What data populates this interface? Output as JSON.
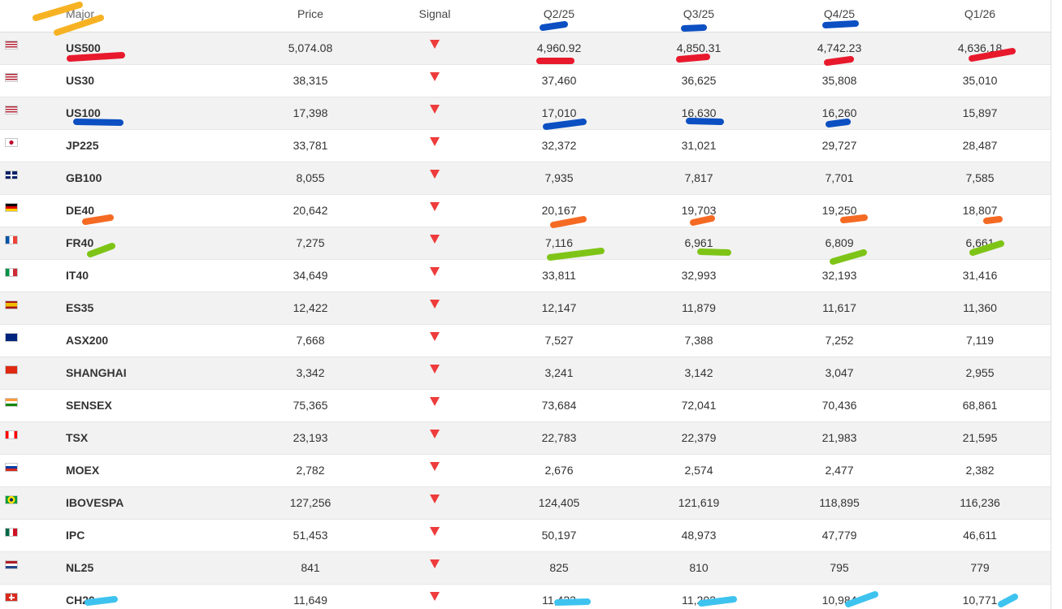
{
  "table": {
    "headers": {
      "major": "Major",
      "price": "Price",
      "signal": "Signal",
      "q1": "Q2/25",
      "q2": "Q3/25",
      "q3": "Q4/25",
      "q4": "Q1/26"
    },
    "signal_color": "#ee3b3b",
    "rows": [
      {
        "flag": "us",
        "name": "US500",
        "price": "5,074.08",
        "signal": "down",
        "q1": "4,960.92",
        "q2": "4,850.31",
        "q3": "4,742.23",
        "q4": "4,636.18"
      },
      {
        "flag": "us",
        "name": "US30",
        "price": "38,315",
        "signal": "down",
        "q1": "37,460",
        "q2": "36,625",
        "q3": "35,808",
        "q4": "35,010"
      },
      {
        "flag": "us",
        "name": "US100",
        "price": "17,398",
        "signal": "down",
        "q1": "17,010",
        "q2": "16,630",
        "q3": "16,260",
        "q4": "15,897"
      },
      {
        "flag": "jp",
        "name": "JP225",
        "price": "33,781",
        "signal": "down",
        "q1": "32,372",
        "q2": "31,021",
        "q3": "29,727",
        "q4": "28,487"
      },
      {
        "flag": "gb",
        "name": "GB100",
        "price": "8,055",
        "signal": "down",
        "q1": "7,935",
        "q2": "7,817",
        "q3": "7,701",
        "q4": "7,585"
      },
      {
        "flag": "de",
        "name": "DE40",
        "price": "20,642",
        "signal": "down",
        "q1": "20,167",
        "q2": "19,703",
        "q3": "19,250",
        "q4": "18,807"
      },
      {
        "flag": "fr",
        "name": "FR40",
        "price": "7,275",
        "signal": "down",
        "q1": "7,116",
        "q2": "6,961",
        "q3": "6,809",
        "q4": "6,661"
      },
      {
        "flag": "it",
        "name": "IT40",
        "price": "34,649",
        "signal": "down",
        "q1": "33,811",
        "q2": "32,993",
        "q3": "32,193",
        "q4": "31,416"
      },
      {
        "flag": "es",
        "name": "ES35",
        "price": "12,422",
        "signal": "down",
        "q1": "12,147",
        "q2": "11,879",
        "q3": "11,617",
        "q4": "11,360"
      },
      {
        "flag": "au",
        "name": "ASX200",
        "price": "7,668",
        "signal": "down",
        "q1": "7,527",
        "q2": "7,388",
        "q3": "7,252",
        "q4": "7,119"
      },
      {
        "flag": "cn",
        "name": "SHANGHAI",
        "price": "3,342",
        "signal": "down",
        "q1": "3,241",
        "q2": "3,142",
        "q3": "3,047",
        "q4": "2,955"
      },
      {
        "flag": "in",
        "name": "SENSEX",
        "price": "75,365",
        "signal": "down",
        "q1": "73,684",
        "q2": "72,041",
        "q3": "70,436",
        "q4": "68,861"
      },
      {
        "flag": "ca",
        "name": "TSX",
        "price": "23,193",
        "signal": "down",
        "q1": "22,783",
        "q2": "22,379",
        "q3": "21,983",
        "q4": "21,595"
      },
      {
        "flag": "ru",
        "name": "MOEX",
        "price": "2,782",
        "signal": "down",
        "q1": "2,676",
        "q2": "2,574",
        "q3": "2,477",
        "q4": "2,382"
      },
      {
        "flag": "br",
        "name": "IBOVESPA",
        "price": "127,256",
        "signal": "down",
        "q1": "124,405",
        "q2": "121,619",
        "q3": "118,895",
        "q4": "116,236"
      },
      {
        "flag": "mx",
        "name": "IPC",
        "price": "51,453",
        "signal": "down",
        "q1": "50,197",
        "q2": "48,973",
        "q3": "47,779",
        "q4": "46,611"
      },
      {
        "flag": "nl",
        "name": "NL25",
        "price": "841",
        "signal": "down",
        "q1": "825",
        "q2": "810",
        "q3": "795",
        "q4": "779"
      },
      {
        "flag": "ch",
        "name": "CH20",
        "price": "11,649",
        "signal": "down",
        "q1": "11,423",
        "q2": "11,202",
        "q3": "10,984",
        "q4": "10,771"
      }
    ]
  },
  "highlight_colors": {
    "yellow": "#f7b223",
    "red": "#e8192c",
    "blue": "#0b4fc2",
    "orange": "#f56a23",
    "green": "#7ec416",
    "cyan": "#3ec3ef"
  }
}
